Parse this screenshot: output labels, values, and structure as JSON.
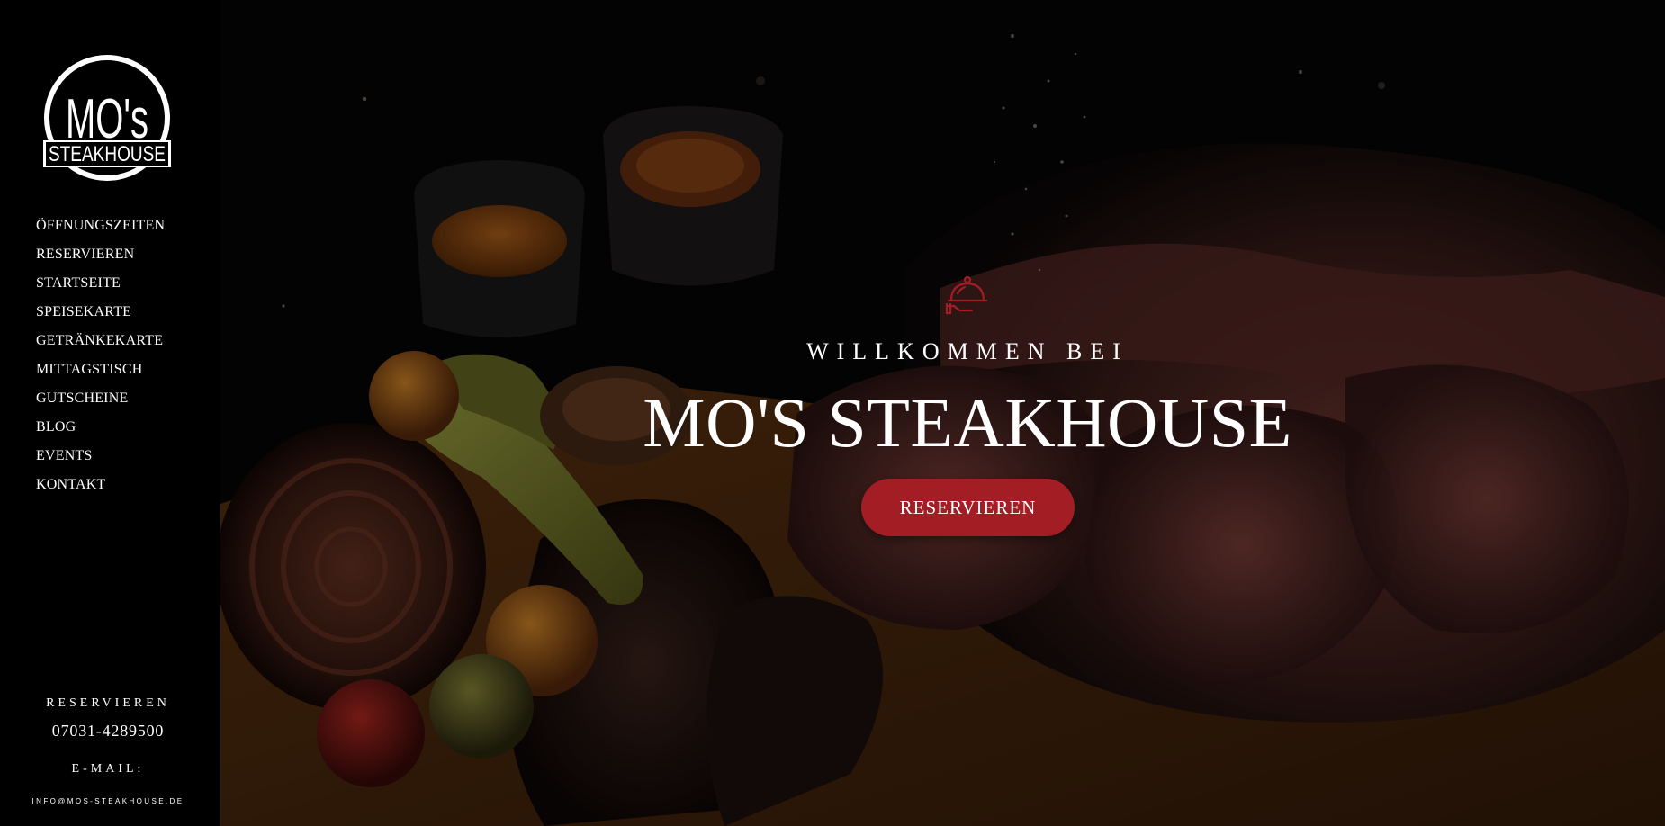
{
  "brand": {
    "logo_top": "MO's",
    "logo_bottom": "STEAKHOUSE"
  },
  "nav": {
    "items": [
      {
        "label": "ÖFFNUNGSZEITEN"
      },
      {
        "label": "RESERVIEREN"
      },
      {
        "label": "STARTSEITE"
      },
      {
        "label": "SPEISEKARTE"
      },
      {
        "label": "GETRÄNKEKARTE"
      },
      {
        "label": "MITTAGSTISCH"
      },
      {
        "label": "GUTSCHEINE"
      },
      {
        "label": "BLOG"
      },
      {
        "label": "EVENTS"
      },
      {
        "label": "KONTAKT"
      }
    ]
  },
  "sidebar_contact": {
    "reserve_label": "RESERVIEREN",
    "phone": "07031-4289500",
    "email_label": "E-MAIL:",
    "email": "INFO@MOS-STEAKHOUSE.DE"
  },
  "hero": {
    "icon": "cloche-icon",
    "welcome": "WILLKOMMEN BEI",
    "title": "MO'S STEAKHOUSE",
    "cta_label": "RESERVIEREN"
  },
  "colors": {
    "accent": "#a31d24",
    "sidebar_bg": "#000000",
    "text": "#ffffff"
  }
}
